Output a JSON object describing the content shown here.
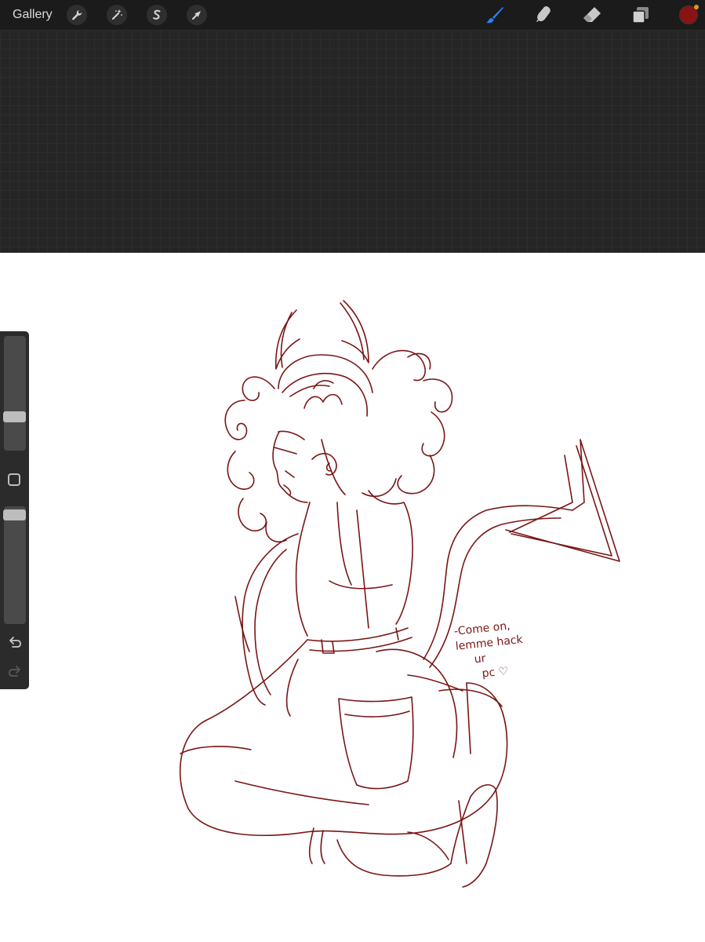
{
  "app": {
    "gallery_label": "Gallery"
  },
  "toolbar": {
    "left_tools": [
      {
        "name": "actions",
        "icon": "wrench-icon"
      },
      {
        "name": "adjustments",
        "icon": "magic-wand-icon"
      },
      {
        "name": "selection",
        "icon": "selection-s-icon"
      },
      {
        "name": "transform",
        "icon": "arrow-cursor-icon"
      }
    ],
    "right_tools": [
      {
        "name": "brush",
        "icon": "brush-icon",
        "active": true,
        "color": "#2d7ff9"
      },
      {
        "name": "smudge",
        "icon": "smudge-finger-icon"
      },
      {
        "name": "eraser",
        "icon": "eraser-icon"
      },
      {
        "name": "layers",
        "icon": "layers-icon"
      }
    ],
    "current_color": "#8a1212",
    "notification_color": "#e0962a"
  },
  "sidebar": {
    "brush_size_level": 0.7,
    "opacity_level": 0.95,
    "modify_icon": "square-modify-icon",
    "undo_icon": "undo-icon",
    "redo_icon": "redo-icon"
  },
  "canvas": {
    "ink_color": "#7a1515",
    "handwritten_text": [
      "-Come on,",
      "lemme hack",
      "ur",
      "pc ♡"
    ]
  }
}
